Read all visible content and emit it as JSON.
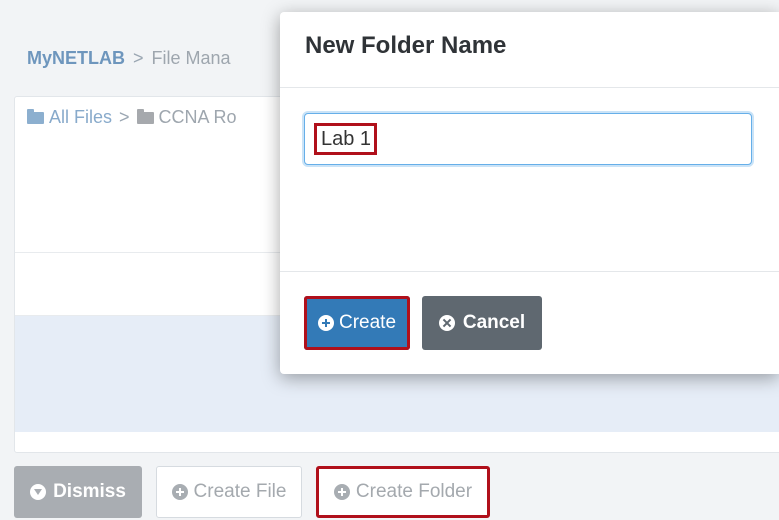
{
  "breadcrumb": {
    "root": "MyNETLAB",
    "separator": ">",
    "current": "File Mana"
  },
  "panel_path": {
    "all_files": "All Files",
    "separator": ">",
    "folder": "CCNA Ro"
  },
  "toolbar": {
    "dismiss_label": "Dismiss",
    "create_file_label": "Create File",
    "create_folder_label": "Create Folder"
  },
  "modal": {
    "title": "New Folder Name",
    "input_value": "Lab 1",
    "create_label": "Create",
    "cancel_label": "Cancel"
  },
  "colors": {
    "primary": "#337ab7",
    "secondary": "#5f6870",
    "highlight": "#b0101b",
    "link": "#6e96bd"
  },
  "icons": {
    "dismiss": "circle-arrow-down-icon",
    "create_file": "plus-circle-icon",
    "create_folder": "plus-circle-icon",
    "create": "plus-circle-icon",
    "cancel": "x-circle-icon",
    "folder": "folder-icon"
  }
}
